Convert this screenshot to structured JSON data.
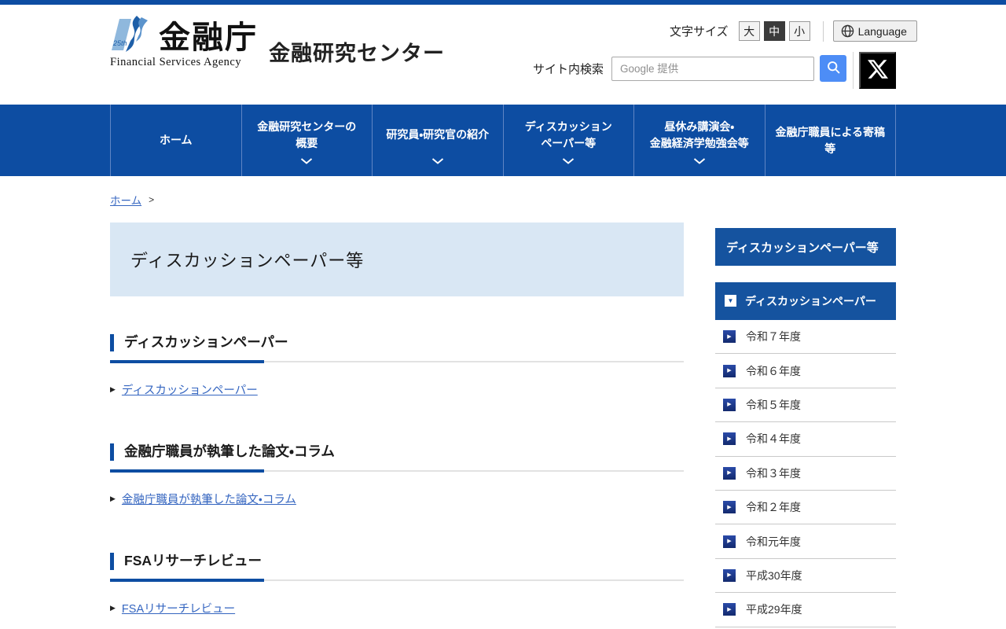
{
  "header": {
    "logo": {
      "agency_name_jp": "金融庁",
      "agency_name_en": "Financial Services Agency",
      "site_name": "金融研究センター"
    },
    "font_size": {
      "label": "文字サイズ",
      "options": [
        {
          "label": "大",
          "selected": false
        },
        {
          "label": "中",
          "selected": true
        },
        {
          "label": "小",
          "selected": false
        }
      ]
    },
    "language_button_label": "Language",
    "search": {
      "label": "サイト内検索",
      "placeholder": "Google 提供"
    }
  },
  "nav": {
    "items": [
      {
        "line1": "ホーム",
        "line2": "",
        "has_submenu": false
      },
      {
        "line1": "金融研究センターの",
        "line2": "概要",
        "has_submenu": true
      },
      {
        "line1": "研究員・研究官の紹介",
        "line2": "",
        "has_submenu": true
      },
      {
        "line1": "ディスカッション",
        "line2": "ペーパー等",
        "has_submenu": true
      },
      {
        "line1": "昼休み講演会・",
        "line2": "金融経済学勉強会等",
        "has_submenu": true
      },
      {
        "line1": "金融庁職員による寄稿",
        "line2": "等",
        "has_submenu": false
      }
    ]
  },
  "breadcrumb": {
    "home": "ホーム",
    "separator": ">"
  },
  "page": {
    "title": "ディスカッションペーパー等"
  },
  "sections": [
    {
      "heading": "ディスカッションペーパー",
      "link": "ディスカッションペーパー"
    },
    {
      "heading": "金融庁職員が執筆した論文・コラム",
      "link": "金融庁職員が執筆した論文・コラム"
    },
    {
      "heading": "FSAリサーチレビュー",
      "link": "FSAリサーチレビュー"
    }
  ],
  "sidebar": {
    "header": "ディスカッションペーパー等",
    "category": "ディスカッションペーパー",
    "items": [
      "令和７年度",
      "令和６年度",
      "令和５年度",
      "令和４年度",
      "令和３年度",
      "令和２年度",
      "令和元年度",
      "平成30年度",
      "平成29年度"
    ]
  },
  "icons": {
    "arrow_marker": "▶",
    "dropdown_marker": "▼"
  },
  "colors": {
    "nav_blue": "#0d4da2",
    "sidebar_blue": "#15539f",
    "banner_light_blue": "#d9e7f4",
    "link_blue": "#3465c0",
    "search_button_blue": "#4d8df6",
    "selected_fontsize_bg": "#3b3b3b",
    "x_button_bg": "#000000"
  }
}
